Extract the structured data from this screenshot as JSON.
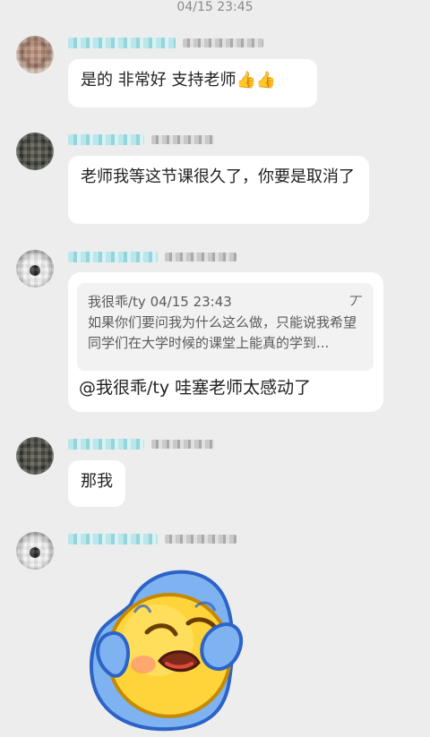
{
  "timestamp": "04/15 23:45",
  "messages": [
    {
      "text": "是的 非常好 支持老师👍👍"
    },
    {
      "text": "老师我等这节课很久了，你要是取消了"
    },
    {
      "quote": {
        "author_time": "我很乖/ty 04/15 23:43",
        "body": "如果你们要问我为什么这么做，只能说我希望同学们在大学时候的课堂上能真的学到..."
      },
      "reply": "@我很乖/ty 哇塞老师太感动了",
      "quote_mark": "丆"
    },
    {
      "text": "那我"
    }
  ],
  "icons": {
    "sticker": "crying-emoji-sticker-icon"
  },
  "colors": {
    "background": "#ededed",
    "bubble": "#ffffff",
    "quote_card": "#f2f2f2",
    "name_blur": "#8fd3da"
  }
}
